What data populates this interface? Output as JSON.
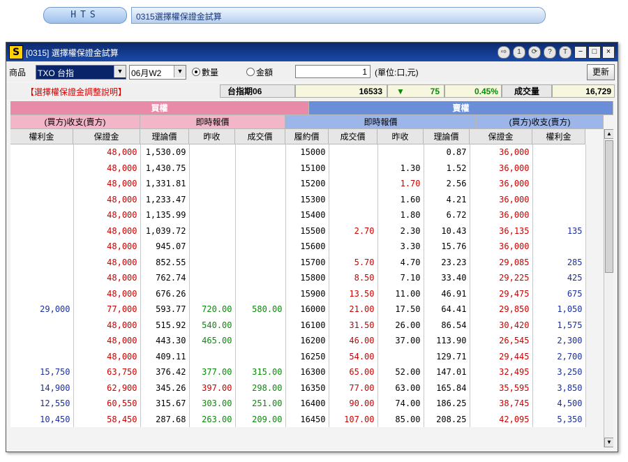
{
  "hts": {
    "logo": "HTS",
    "screen_title": "0315選擇權保證金試算"
  },
  "window": {
    "icon_letter": "S",
    "title": "[0315] 選擇權保證金試算",
    "tool_icons": [
      "⇨",
      "1",
      "⟳",
      "?",
      "T"
    ],
    "controls": [
      "−",
      "□",
      "×"
    ]
  },
  "toolbar": {
    "product_label": "商品",
    "product_value": "TXO 台指",
    "month_value": "06月W2",
    "radio_qty": "數量",
    "radio_amount": "金額",
    "qty_value": "1",
    "unit_label": "(單位:口,元)",
    "update_button": "更新"
  },
  "info": {
    "explain_link": "【選擇權保證金調整說明】",
    "futures_name": "台指期06",
    "futures_price": "16533",
    "change_arrow": "▼",
    "change_value": "75",
    "change_pct": "0.45%",
    "volume_label": "成交量",
    "volume_value": "16,729"
  },
  "headers": {
    "call": "買權",
    "put": "賣權",
    "call_margin_group": "(買方)收支(賣方)",
    "call_quote_group": "即時報價",
    "put_quote_group": "即時報價",
    "put_margin_group": "(買方)收支(賣方)",
    "columns": [
      "權利金",
      "保證金",
      "理論價",
      "昨收",
      "成交價",
      "履約價",
      "成交價",
      "昨收",
      "理論價",
      "保證金",
      "權利金"
    ]
  },
  "colors": {
    "call_header": "#e88aa8",
    "put_header": "#6a8fd8",
    "up_red": "#cc0000",
    "down_green": "#0a8a0a",
    "blue_text": "#1a2fa0"
  },
  "rows": [
    [
      "",
      "48,000",
      "1,530.09",
      "",
      "",
      "15000",
      "",
      "",
      "0.87",
      "36,000",
      ""
    ],
    [
      "",
      "48,000",
      "1,430.75",
      "",
      "",
      "15100",
      "",
      "1.30",
      "1.52",
      "36,000",
      ""
    ],
    [
      "",
      "48,000",
      "1,331.81",
      "",
      "",
      "15200",
      "",
      "1.70",
      "2.56",
      "36,000",
      ""
    ],
    [
      "",
      "48,000",
      "1,233.47",
      "",
      "",
      "15300",
      "",
      "1.60",
      "4.21",
      "36,000",
      ""
    ],
    [
      "",
      "48,000",
      "1,135.99",
      "",
      "",
      "15400",
      "",
      "1.80",
      "6.72",
      "36,000",
      ""
    ],
    [
      "",
      "48,000",
      "1,039.72",
      "",
      "",
      "15500",
      "2.70",
      "2.30",
      "10.43",
      "36,135",
      "135"
    ],
    [
      "",
      "48,000",
      "945.07",
      "",
      "",
      "15600",
      "",
      "3.30",
      "15.76",
      "36,000",
      ""
    ],
    [
      "",
      "48,000",
      "852.55",
      "",
      "",
      "15700",
      "5.70",
      "4.70",
      "23.23",
      "29,085",
      "285"
    ],
    [
      "",
      "48,000",
      "762.74",
      "",
      "",
      "15800",
      "8.50",
      "7.10",
      "33.40",
      "29,225",
      "425"
    ],
    [
      "",
      "48,000",
      "676.26",
      "",
      "",
      "15900",
      "13.50",
      "11.00",
      "46.91",
      "29,475",
      "675"
    ],
    [
      "29,000",
      "77,000",
      "593.77",
      "720.00",
      "580.00",
      "16000",
      "21.00",
      "17.50",
      "64.41",
      "29,850",
      "1,050"
    ],
    [
      "",
      "48,000",
      "515.92",
      "540.00",
      "",
      "16100",
      "31.50",
      "26.00",
      "86.54",
      "30,420",
      "1,575"
    ],
    [
      "",
      "48,000",
      "443.30",
      "465.00",
      "",
      "16200",
      "46.00",
      "37.00",
      "113.90",
      "26,545",
      "2,300"
    ],
    [
      "",
      "48,000",
      "409.11",
      "",
      "",
      "16250",
      "54.00",
      "",
      "129.71",
      "29,445",
      "2,700"
    ],
    [
      "15,750",
      "63,750",
      "376.42",
      "377.00",
      "315.00",
      "16300",
      "65.00",
      "52.00",
      "147.01",
      "32,495",
      "3,250"
    ],
    [
      "14,900",
      "62,900",
      "345.26",
      "397.00",
      "298.00",
      "16350",
      "77.00",
      "63.00",
      "165.84",
      "35,595",
      "3,850"
    ],
    [
      "12,550",
      "60,550",
      "315.67",
      "303.00",
      "251.00",
      "16400",
      "90.00",
      "74.00",
      "186.25",
      "38,745",
      "4,500"
    ],
    [
      "10,450",
      "58,450",
      "287.68",
      "263.00",
      "209.00",
      "16450",
      "107.00",
      "85.00",
      "208.25",
      "42,095",
      "5,350"
    ]
  ],
  "row_colors": [
    [
      "",
      "red",
      "black",
      "",
      "",
      "black",
      "",
      "black",
      "black",
      "red",
      ""
    ],
    [
      "",
      "red",
      "black",
      "",
      "",
      "black",
      "",
      "black",
      "black",
      "red",
      ""
    ],
    [
      "",
      "red",
      "black",
      "",
      "",
      "black",
      "",
      "red",
      "black",
      "red",
      ""
    ],
    [
      "",
      "red",
      "black",
      "",
      "",
      "black",
      "",
      "black",
      "black",
      "red",
      ""
    ],
    [
      "",
      "red",
      "black",
      "",
      "",
      "black",
      "",
      "black",
      "black",
      "red",
      ""
    ],
    [
      "",
      "red",
      "black",
      "",
      "",
      "black",
      "red",
      "black",
      "black",
      "red",
      "blue"
    ],
    [
      "",
      "red",
      "black",
      "",
      "",
      "black",
      "",
      "black",
      "black",
      "red",
      ""
    ],
    [
      "",
      "red",
      "black",
      "",
      "",
      "black",
      "red",
      "black",
      "black",
      "red",
      "blue"
    ],
    [
      "",
      "red",
      "black",
      "",
      "",
      "black",
      "red",
      "black",
      "black",
      "red",
      "blue"
    ],
    [
      "",
      "red",
      "black",
      "",
      "",
      "black",
      "red",
      "black",
      "black",
      "red",
      "blue"
    ],
    [
      "blue",
      "red",
      "black",
      "green",
      "green",
      "black",
      "red",
      "black",
      "black",
      "red",
      "blue"
    ],
    [
      "",
      "red",
      "black",
      "green",
      "",
      "black",
      "red",
      "black",
      "black",
      "red",
      "blue"
    ],
    [
      "",
      "red",
      "black",
      "green",
      "",
      "black",
      "red",
      "black",
      "black",
      "red",
      "blue"
    ],
    [
      "",
      "red",
      "black",
      "",
      "",
      "black",
      "red",
      "",
      "black",
      "red",
      "blue"
    ],
    [
      "blue",
      "red",
      "black",
      "green",
      "green",
      "black",
      "red",
      "black",
      "black",
      "red",
      "blue"
    ],
    [
      "blue",
      "red",
      "black",
      "red",
      "green",
      "black",
      "red",
      "black",
      "black",
      "red",
      "blue"
    ],
    [
      "blue",
      "red",
      "black",
      "green",
      "green",
      "black",
      "red",
      "black",
      "black",
      "red",
      "blue"
    ],
    [
      "blue",
      "red",
      "black",
      "green",
      "green",
      "black",
      "red",
      "black",
      "black",
      "red",
      "blue"
    ]
  ]
}
